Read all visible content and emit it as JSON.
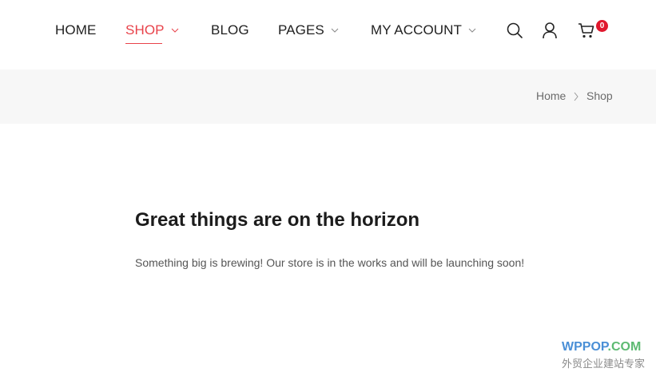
{
  "nav": {
    "items": [
      {
        "label": "HOME"
      },
      {
        "label": "SHOP"
      },
      {
        "label": "BLOG"
      },
      {
        "label": "PAGES"
      },
      {
        "label": "MY ACCOUNT"
      }
    ],
    "active_color": "#e8424a",
    "cart_count": "0",
    "icons": [
      "search-icon",
      "user-icon",
      "cart-icon"
    ]
  },
  "breadcrumb": {
    "home": "Home",
    "current": "Shop"
  },
  "main": {
    "headline": "Great things are on the horizon",
    "subtext": "Something big is brewing! Our store is in the works and will be launching soon!"
  },
  "watermark": {
    "brand": "WPPOP",
    "tld": ".COM",
    "tagline": "外贸企业建站专家"
  }
}
